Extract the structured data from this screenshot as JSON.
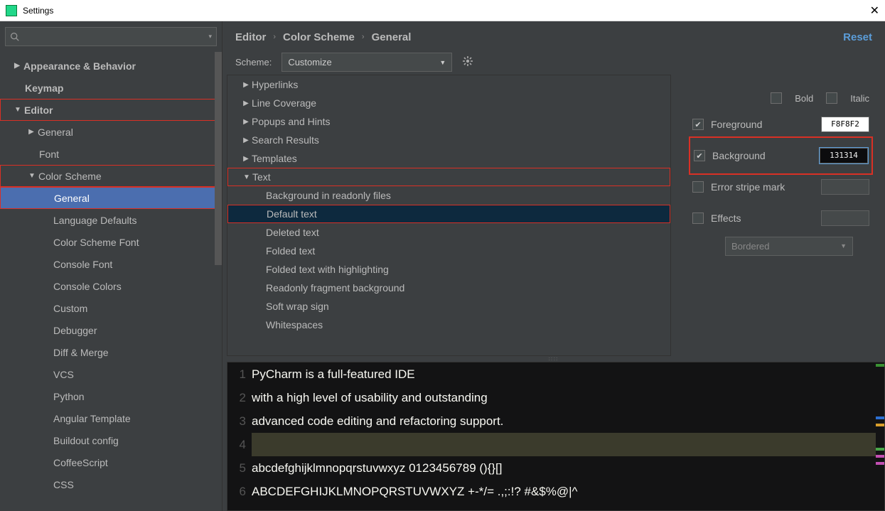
{
  "window": {
    "title": "Settings"
  },
  "search": {
    "placeholder": ""
  },
  "sidebar": {
    "items": [
      {
        "label": "Appearance & Behavior",
        "lvl": 1,
        "arrow": "right",
        "bold": true
      },
      {
        "label": "Keymap",
        "lvl": 1,
        "bold": true
      },
      {
        "label": "Editor",
        "lvl": 1,
        "arrow": "down",
        "bold": true,
        "red": true
      },
      {
        "label": "General",
        "lvl": 2,
        "arrow": "right"
      },
      {
        "label": "Font",
        "lvl": 2
      },
      {
        "label": "Color Scheme",
        "lvl": 2,
        "arrow": "down",
        "red": true
      },
      {
        "label": "General",
        "lvl": 3,
        "selected": true,
        "red": true
      },
      {
        "label": "Language Defaults",
        "lvl": 3
      },
      {
        "label": "Color Scheme Font",
        "lvl": 3
      },
      {
        "label": "Console Font",
        "lvl": 3
      },
      {
        "label": "Console Colors",
        "lvl": 3
      },
      {
        "label": "Custom",
        "lvl": 3
      },
      {
        "label": "Debugger",
        "lvl": 3
      },
      {
        "label": "Diff & Merge",
        "lvl": 3
      },
      {
        "label": "VCS",
        "lvl": 3
      },
      {
        "label": "Python",
        "lvl": 3
      },
      {
        "label": "Angular Template",
        "lvl": 3
      },
      {
        "label": "Buildout config",
        "lvl": 3
      },
      {
        "label": "CoffeeScript",
        "lvl": 3
      },
      {
        "label": "CSS",
        "lvl": 3
      }
    ]
  },
  "breadcrumb": {
    "a": "Editor",
    "b": "Color Scheme",
    "c": "General",
    "reset": "Reset"
  },
  "scheme": {
    "label": "Scheme:",
    "value": "Customize"
  },
  "categories": [
    {
      "label": "Hyperlinks",
      "arrow": "right"
    },
    {
      "label": "Line Coverage",
      "arrow": "right"
    },
    {
      "label": "Popups and Hints",
      "arrow": "right"
    },
    {
      "label": "Search Results",
      "arrow": "right"
    },
    {
      "label": "Templates",
      "arrow": "right"
    },
    {
      "label": "Text",
      "arrow": "down",
      "red": true
    },
    {
      "label": "Background in readonly files",
      "child": true
    },
    {
      "label": "Default text",
      "child": true,
      "selected": true,
      "red": true
    },
    {
      "label": "Deleted text",
      "child": true
    },
    {
      "label": "Folded text",
      "child": true
    },
    {
      "label": "Folded text with highlighting",
      "child": true
    },
    {
      "label": "Readonly fragment background",
      "child": true
    },
    {
      "label": "Soft wrap sign",
      "child": true
    },
    {
      "label": "Whitespaces",
      "child": true
    }
  ],
  "props": {
    "bold": "Bold",
    "italic": "Italic",
    "foreground": "Foreground",
    "fg_value": "F8F8F2",
    "background": "Background",
    "bg_value": "131314",
    "stripe": "Error stripe mark",
    "effects": "Effects",
    "effects_type": "Bordered"
  },
  "preview": {
    "lines": [
      "PyCharm is a full-featured IDE",
      "with a high level of usability and outstanding",
      "advanced code editing and refactoring support.",
      "",
      "abcdefghijklmnopqrstuvwxyz 0123456789 (){}[]",
      "ABCDEFGHIJKLMNOPQRSTUVWXYZ +-*/= .,;:!? #&$%@|^"
    ]
  }
}
